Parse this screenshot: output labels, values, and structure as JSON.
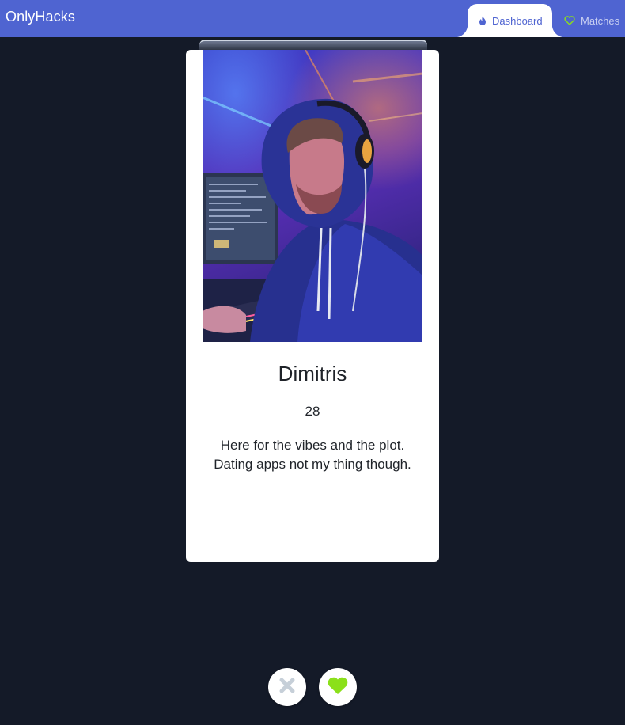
{
  "brand": {
    "title": "OnlyHacks"
  },
  "nav": {
    "tabs": [
      {
        "label": "Dashboard",
        "icon": "flame-icon",
        "active": true
      },
      {
        "label": "Matches",
        "icon": "heart-outline-icon",
        "active": false
      }
    ]
  },
  "profile": {
    "photo": "profile-photo",
    "name": "Dimitris",
    "age": "28",
    "bio": "Here for the vibes and the plot. Dating apps not my thing though."
  },
  "actions": {
    "dislike": {
      "icon": "x-icon"
    },
    "like": {
      "icon": "heart-icon"
    }
  },
  "colors": {
    "navbar": "#4f64d1",
    "background": "#141a28",
    "card": "#ffffff",
    "like": "#8be01a",
    "dislike": "#c6cfd8"
  }
}
